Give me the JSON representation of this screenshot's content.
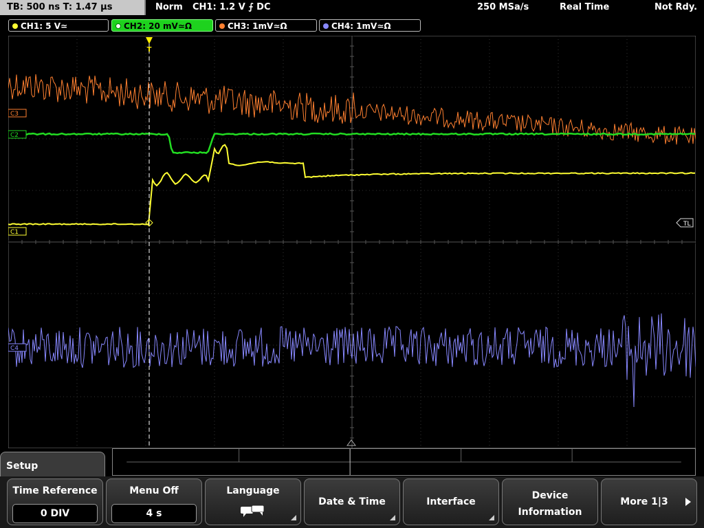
{
  "topbar": {
    "timebase": "TB: 500 ns   T: 1.47 µs",
    "mode": "Norm",
    "trigger": "CH1: 1.2 V ⨍ DC",
    "sample_rate": "250 MSa/s",
    "acq": "Real Time",
    "status": "Not Rdy."
  },
  "channels": [
    {
      "label": "CH1: 5 V≃",
      "color": "#ffff33"
    },
    {
      "label": "CH2: 20 mV≃Ω",
      "color": "#22dd22"
    },
    {
      "label": "CH3: 1mV≃Ω",
      "color": "#ff8030"
    },
    {
      "label": "CH4: 1mV≃Ω",
      "color": "#8888ff"
    }
  ],
  "markers": {
    "c1": "C1",
    "c2": "C2",
    "c3": "C3",
    "c4": "C4",
    "trigger_level": "TL",
    "trigger_pos": "T"
  },
  "menu": {
    "title": "Setup",
    "keys": [
      {
        "label": "Time Reference",
        "value": "0 DIV"
      },
      {
        "label": "Menu Off",
        "value": "4 s"
      },
      {
        "label": "Language",
        "icon": "speech-bubbles-icon"
      },
      {
        "label": "Date & Time"
      },
      {
        "label": "Interface"
      },
      {
        "label1": "Device",
        "label2": "Information"
      },
      {
        "label": "More 1|3"
      }
    ]
  }
}
